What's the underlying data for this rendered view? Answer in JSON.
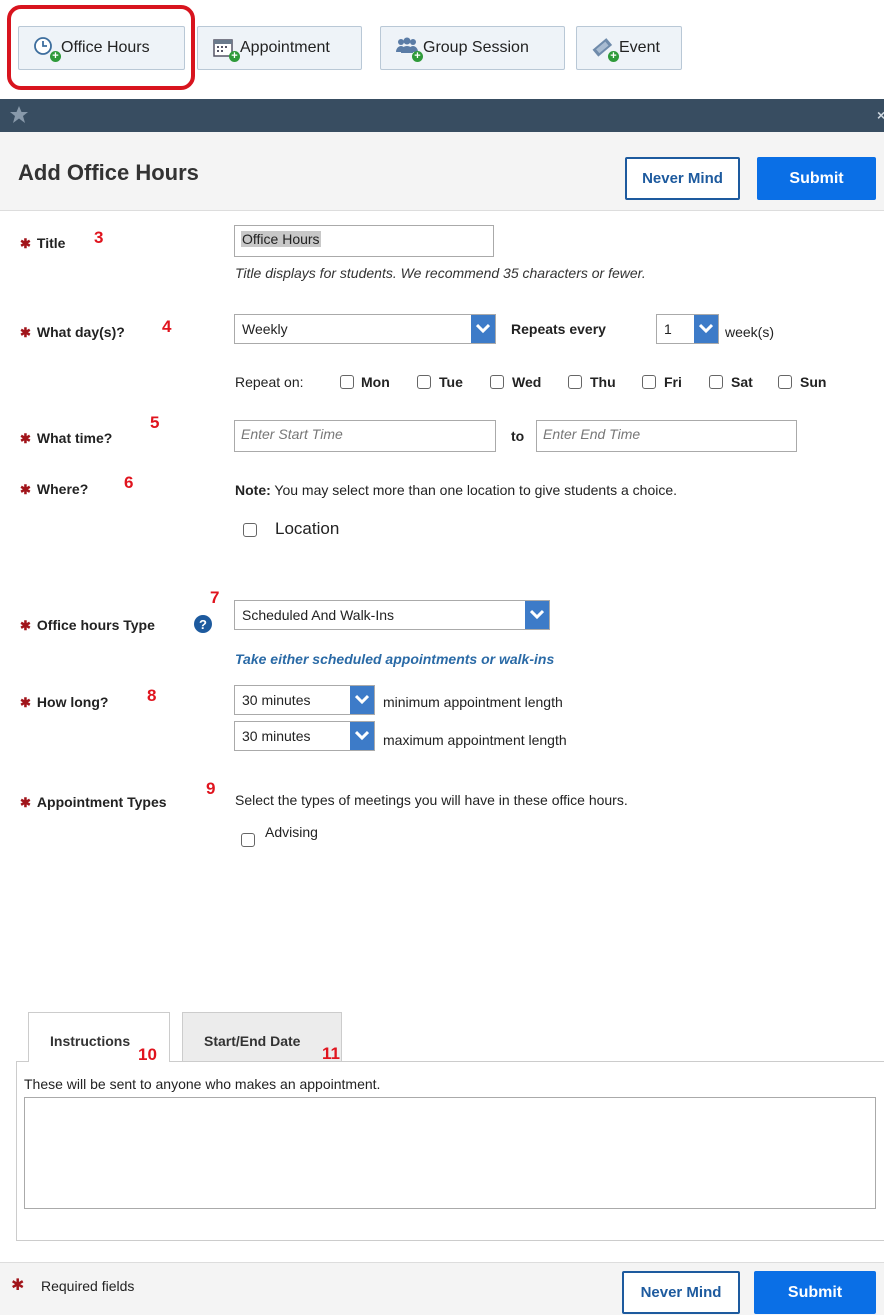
{
  "toolbar": {
    "office_hours": "Office Hours",
    "appointment": "Appointment",
    "group_session": "Group Session",
    "event": "Event"
  },
  "header": {
    "title": "Add Office Hours",
    "never_mind": "Never Mind",
    "submit": "Submit"
  },
  "form": {
    "title_label": "Title",
    "title_num": "3",
    "title_value": "Office Hours",
    "title_hint": "Title displays for students. We recommend 35 characters or fewer.",
    "days_label": "What day(s)?",
    "days_num": "4",
    "days_value": "Weekly",
    "repeats_every": "Repeats every",
    "repeat_count": "1",
    "weeks": "week(s)",
    "repeat_on": "Repeat on:",
    "days": [
      "Mon",
      "Tue",
      "Wed",
      "Thu",
      "Fri",
      "Sat",
      "Sun"
    ],
    "time_label": "What time?",
    "time_num": "5",
    "start_placeholder": "Enter Start Time",
    "to": "to",
    "end_placeholder": "Enter End Time",
    "where_label": "Where?",
    "where_num": "6",
    "note_bold": "Note:",
    "note_text": " You may select more than one location to give students a choice.",
    "location": "Location",
    "type_label": "Office hours Type",
    "type_num": "7",
    "type_value": "Scheduled And Walk-Ins",
    "type_hint": "Take either scheduled appointments or walk-ins",
    "howlong_label": "How long?",
    "howlong_num": "8",
    "min_value": "30 minutes",
    "min_label": "minimum appointment length",
    "max_value": "30 minutes",
    "max_label": "maximum appointment length",
    "appt_label": "Appointment Types",
    "appt_num": "9",
    "appt_text": "Select the types of meetings you will have in these office hours.",
    "advising": "Advising"
  },
  "tabs": {
    "instructions": "Instructions",
    "instructions_num": "10",
    "dates": "Start/End Date",
    "dates_num": "11",
    "panel_text": "These will be sent to anyone who makes an appointment."
  },
  "footer": {
    "required": "Required fields",
    "never_mind": "Never Mind",
    "submit": "Submit"
  },
  "colors": {
    "accent": "#0a6fe6",
    "dark_bar": "#384d61",
    "required_star": "#a1141a",
    "annotation": "#e0141e",
    "highlight": "#d8141e"
  }
}
